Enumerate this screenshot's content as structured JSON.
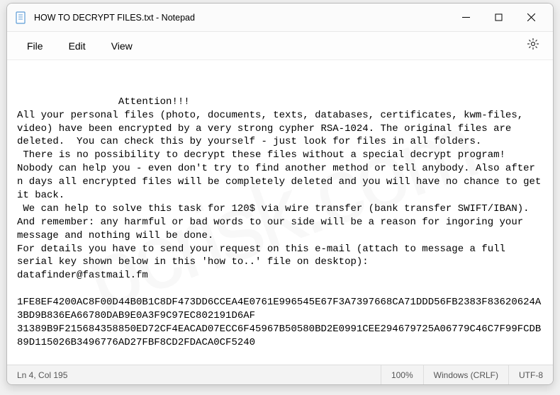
{
  "window": {
    "title": "HOW TO DECRYPT FILES.txt - Notepad"
  },
  "menu": {
    "file": "File",
    "edit": "Edit",
    "view": "View"
  },
  "content": {
    "body": "             Attention!!!\nAll your personal files (photo, documents, texts, databases, certificates, kwm-files, video) have been encrypted by a very strong cypher RSA-1024. The original files are deleted.  You can check this by yourself - just look for files in all folders.\n There is no possibility to decrypt these files without a special decrypt program! Nobody can help you - even don't try to find another method or tell anybody. Also after n days all encrypted files will be completely deleted and you will have no chance to get it back.\n We can help to solve this task for 120$ via wire transfer (bank transfer SWIFT/IBAN). And remember: any harmful or bad words to our side will be a reason for ingoring your message and nothing will be done.\nFor details you have to send your request on this e-mail (attach to message a full serial key shown below in this 'how to..' file on desktop):\ndatafinder@fastmail.fm\n\n1FE8EF4200AC8F00D44B0B1C8DF473DD6CCEA4E0761E996545E67F3A7397668CA71DDD56FB2383F83620624A3BD9B836EA66780DAB9E0A3F9C97EC802191D6AF\n31389B9F215684358850ED72CF4EACAD07ECC6F45967B50580BD2E0991CEE294679725A06779C46C7F99FCDB89D115026B3496776AD27FBF8CD2FDACA0CF5240"
  },
  "statusbar": {
    "position": "Ln 4, Col 195",
    "zoom": "100%",
    "line_ending": "Windows (CRLF)",
    "encoding": "UTF-8"
  }
}
